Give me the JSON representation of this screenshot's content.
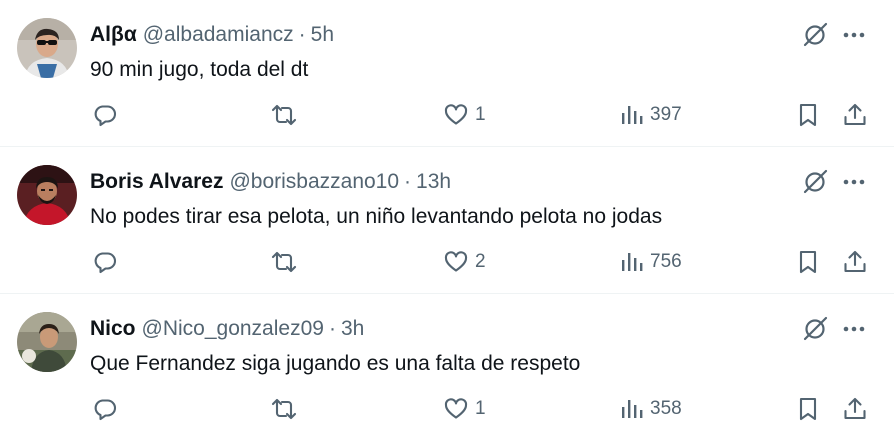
{
  "tweets": [
    {
      "name": "Alβα",
      "handle": "@albadamiancz",
      "separator": "·",
      "time": "5h",
      "text": "90 min jugo, toda del dt",
      "likes": "1",
      "views": "397",
      "avatar_colors": {
        "bg": "#c9c3bb",
        "skin": "#d9a98a",
        "hair": "#2b2320",
        "shirt": "#e8e8e8"
      }
    },
    {
      "name": "Boris Alvarez",
      "handle": "@borisbazzano10",
      "separator": "·",
      "time": "13h",
      "text": "No podes tirar esa pelota, un niño levantando pelota no jodas",
      "likes": "2",
      "views": "756",
      "avatar_colors": {
        "bg": "#5a1f22",
        "skin": "#b97f60",
        "hair": "#1c1412",
        "shirt": "#c4162a"
      }
    },
    {
      "name": "Nico",
      "handle": "@Nico_gonzalez09",
      "separator": "·",
      "time": "3h",
      "text": "Que Fernandez siga jugando es una falta de respeto",
      "likes": "1",
      "views": "358",
      "avatar_colors": {
        "bg": "#8d8a78",
        "skin": "#c99a78",
        "hair": "#2a2018",
        "shirt": "#3f4a3a"
      }
    }
  ],
  "colors": {
    "text": "#0f1419",
    "secondary": "#536471",
    "divider": "#eff3f4"
  },
  "icons": {
    "reply": "reply-icon",
    "retweet": "retweet-icon",
    "like": "heart-icon",
    "views": "views-icon",
    "bookmark": "bookmark-icon",
    "share": "share-icon",
    "grok": "grok-icon",
    "more": "more-icon"
  }
}
